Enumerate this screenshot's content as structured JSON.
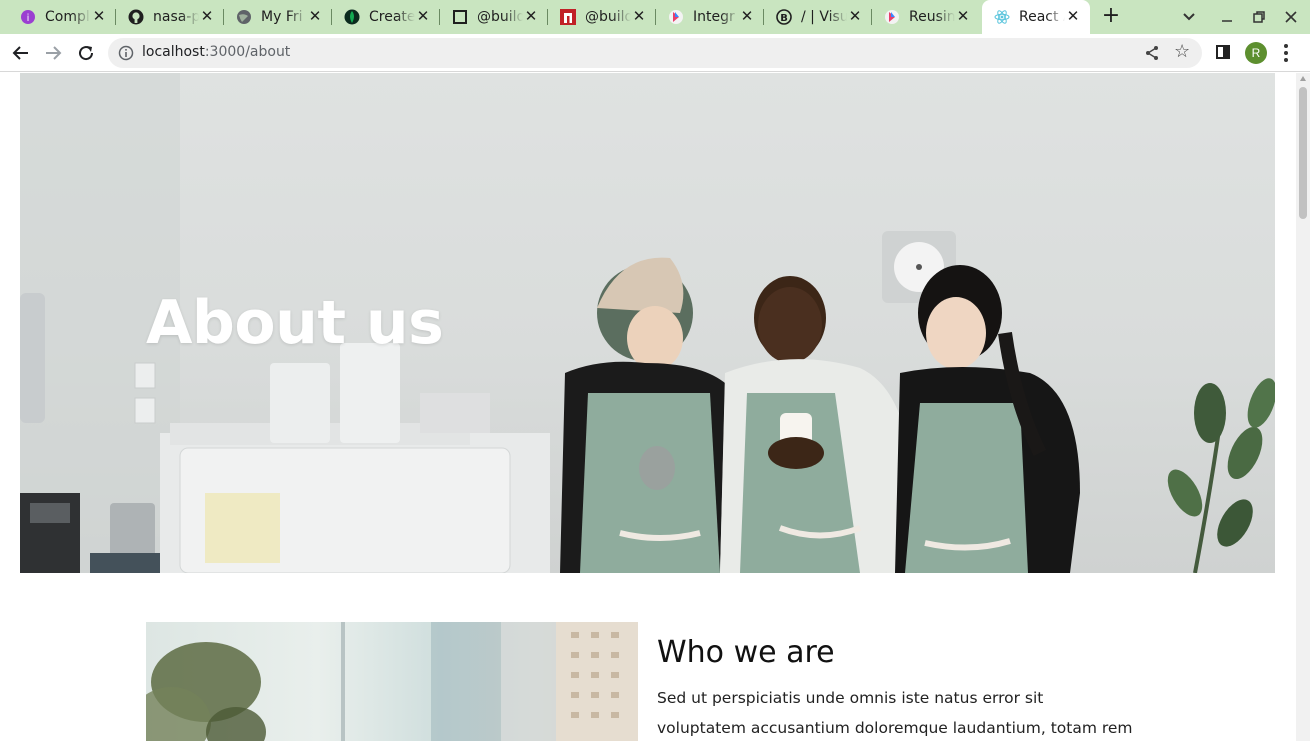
{
  "browser": {
    "tabs": [
      {
        "title": "Compl",
        "icon": "purple-circle-icon"
      },
      {
        "title": "nasa-p",
        "icon": "github-icon"
      },
      {
        "title": "My Fri",
        "icon": "globe-icon"
      },
      {
        "title": "Create",
        "icon": "leaf-icon"
      },
      {
        "title": "@build",
        "icon": "square-icon"
      },
      {
        "title": "@build",
        "icon": "npm-icon"
      },
      {
        "title": "Integr",
        "icon": "builder-icon"
      },
      {
        "title": "/ | Visu",
        "icon": "b-circle-icon"
      },
      {
        "title": "Reusin",
        "icon": "builder-icon"
      },
      {
        "title": "React A",
        "icon": "react-icon",
        "active": true
      }
    ],
    "url_host": "localhost",
    "url_path": ":3000/about",
    "profile_initial": "R",
    "accent": "#c9e5c0"
  },
  "page": {
    "hero_title": "About us",
    "section_title": "Who we are",
    "section_body": "Sed ut perspiciatis unde omnis iste natus error sit voluptatem accusantium doloremque laudantium, totam rem aperiam, eaque"
  }
}
